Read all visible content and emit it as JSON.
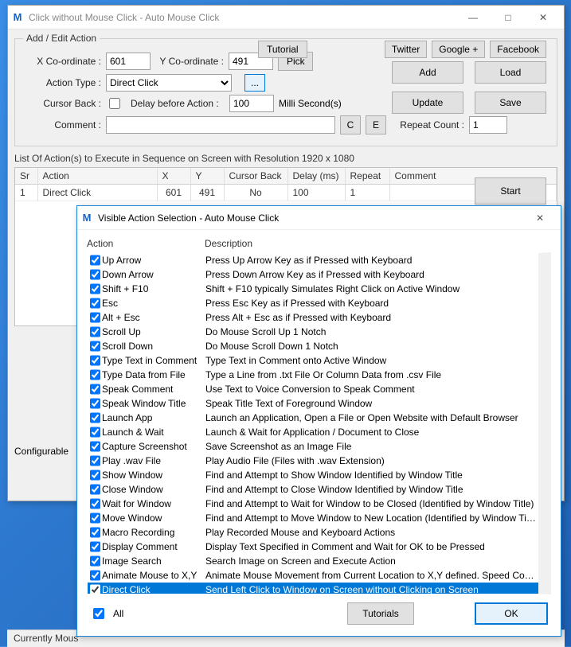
{
  "main": {
    "title": "Click without Mouse Click - Auto Mouse Click",
    "links": {
      "tutorial": "Tutorial",
      "twitter": "Twitter",
      "google": "Google +",
      "facebook": "Facebook"
    },
    "addEdit": {
      "legend": "Add / Edit Action",
      "xLabel": "X Co-ordinate :",
      "x": "601",
      "yLabel": "Y Co-ordinate :",
      "y": "491",
      "pick": "Pick",
      "actionTypeLabel": "Action Type :",
      "actionType": "Direct Click",
      "dotdot": "...",
      "cursorBackLabel": "Cursor Back :",
      "delayLabel": "Delay before Action :",
      "delay": "100",
      "delayUnit": "Milli Second(s)",
      "commentLabel": "Comment :",
      "comment": "",
      "c": "C",
      "e": "E",
      "repeatLabel": "Repeat Count :",
      "repeat": "1"
    },
    "buttons": {
      "add": "Add",
      "load": "Load",
      "update": "Update",
      "save": "Save",
      "start": "Start"
    },
    "listCaption": "List Of Action(s) to Execute in Sequence on Screen with Resolution 1920 x 1080",
    "grid": {
      "headers": {
        "sr": "Sr",
        "action": "Action",
        "x": "X",
        "y": "Y",
        "cursor": "Cursor Back",
        "delay": "Delay (ms)",
        "repeat": "Repeat",
        "comment": "Comment"
      },
      "rows": [
        {
          "sr": "1",
          "action": "Direct Click",
          "x": "601",
          "y": "491",
          "cursor": "No",
          "delay": "100",
          "repeat": "1",
          "comment": ""
        }
      ]
    },
    "configurable": "Configurable",
    "status": "Currently Mous"
  },
  "modal": {
    "title": "Visible Action Selection - Auto Mouse Click",
    "headAction": "Action",
    "headDesc": "Description",
    "items": [
      {
        "a": "Up Arrow",
        "d": "Press Up Arrow Key as if Pressed with Keyboard"
      },
      {
        "a": "Down Arrow",
        "d": "Press Down Arrow Key as if Pressed with Keyboard"
      },
      {
        "a": "Shift + F10",
        "d": "Shift + F10 typically Simulates Right Click on Active Window"
      },
      {
        "a": "Esc",
        "d": "Press Esc Key as if Pressed with Keyboard"
      },
      {
        "a": "Alt + Esc",
        "d": "Press Alt + Esc as if Pressed with Keyboard"
      },
      {
        "a": "Scroll Up",
        "d": "Do Mouse Scroll Up 1 Notch"
      },
      {
        "a": "Scroll Down",
        "d": "Do Mouse Scroll Down 1 Notch"
      },
      {
        "a": "Type Text in Comment",
        "d": "Type Text in Comment onto Active Window"
      },
      {
        "a": "Type Data from File",
        "d": "Type a Line from .txt File Or Column Data from .csv File"
      },
      {
        "a": "Speak Comment",
        "d": "Use Text to Voice Conversion to Speak Comment"
      },
      {
        "a": "Speak Window Title",
        "d": "Speak Title Text of Foreground Window"
      },
      {
        "a": "Launch App",
        "d": "Launch an Application, Open a File or Open Website with Default Browser"
      },
      {
        "a": "Launch & Wait",
        "d": "Launch & Wait for Application / Document to Close"
      },
      {
        "a": "Capture Screenshot",
        "d": "Save Screenshot as an Image File"
      },
      {
        "a": "Play .wav File",
        "d": "Play Audio File (Files with .wav Extension)"
      },
      {
        "a": "Show Window",
        "d": "Find and Attempt to Show Window Identified by Window Title"
      },
      {
        "a": "Close Window",
        "d": "Find and Attempt to Close Window Identified by Window Title"
      },
      {
        "a": "Wait for Window",
        "d": "Find and Attempt to Wait for Window to be Closed (Identified by Window Title)"
      },
      {
        "a": "Move Window",
        "d": "Find and Attempt to Move Window to New Location (Identified by Window Title)"
      },
      {
        "a": "Macro Recording",
        "d": "Play Recorded Mouse and Keyboard Actions"
      },
      {
        "a": "Display Comment",
        "d": "Display Text Specified in Comment and Wait for OK to be Pressed"
      },
      {
        "a": "Image Search",
        "d": "Search Image on Screen and Execute Action"
      },
      {
        "a": "Animate Mouse to X,Y",
        "d": "Animate Mouse Movement from Current Location to X,Y defined. Speed Controllabl..."
      },
      {
        "a": "Direct Click",
        "d": "Send Left Click to Window on Screen without Clicking on Screen",
        "sel": true
      }
    ],
    "all": "All",
    "tutorials": "Tutorials",
    "ok": "OK"
  }
}
